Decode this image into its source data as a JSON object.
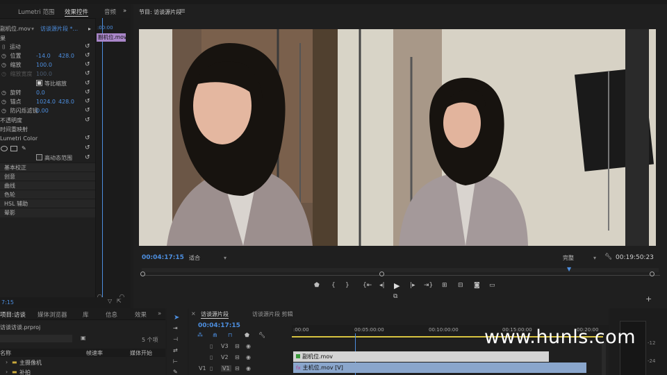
{
  "effect_controls": {
    "tabs": [
      "Lumetri 范围",
      "效果控件",
      "音频"
    ],
    "source_label": "副机位.mov",
    "sequence_label": "访谈源片段 *...",
    "timecode_short": ":00:00",
    "clip_name": "副机位.mov",
    "section_video": "果",
    "motion": "运动",
    "position_label": "位置",
    "position_x": "-14.0",
    "position_y": "428.0",
    "scale_label": "缩放",
    "scale_value": "100.0",
    "scale_width_label": "缩放宽度",
    "scale_width_value": "100.0",
    "uniform_scale": "等比缩放",
    "rotation_label": "旋转",
    "rotation_value": "0.0",
    "anchor_label": "锚点",
    "anchor_x": "1024.0",
    "anchor_y": "428.0",
    "flicker_label": "防闪烁滤镜",
    "flicker_value": "0.00",
    "opacity": "不透明度",
    "time_remap": "时间重映射",
    "lumetri": "Lumetri Color",
    "hdr": "高动态范围",
    "basic": "基本校正",
    "creative": "创意",
    "curves": "曲线",
    "wheels": "色轮",
    "hsl": "HSL 辅助",
    "vignette": "晕影",
    "bottom_tc": "7:15"
  },
  "program": {
    "title": "节目: 访谈源片段",
    "timecode": "00:04:17:15",
    "fit": "适合",
    "quality": "完整",
    "duration": "00:19:50:23"
  },
  "project": {
    "tabs": [
      "项目:访谈",
      "媒体浏览器",
      "库",
      "信息",
      "效果"
    ],
    "file": "访谈访谈.prproj",
    "count": "5 个项",
    "columns": [
      "名称",
      "帧速率",
      "媒体开始"
    ],
    "items": [
      "主摄像机",
      "补拍"
    ]
  },
  "timeline": {
    "tabs": [
      "访谈源片段",
      "访谈源片段 剪辑"
    ],
    "timecode": "00:04:17:15",
    "ruler": [
      ":00:00",
      "00:05:00:00",
      "00:10:00:00",
      "00:15:00:00",
      "00:20:00"
    ],
    "tracks": [
      "V3",
      "V2",
      "V1"
    ],
    "clip_v2": "副机位.mov",
    "clip_v1": "主机位.mov [V]"
  },
  "meter": {
    "scale": [
      "-12",
      "-24"
    ]
  },
  "watermark": "www.hunls.com",
  "colors": {
    "accent": "#4d8fe0",
    "clip_purple": "#a986c9",
    "clip_v1": "#8aa6cc",
    "clip_v2": "#d3d3d3"
  }
}
